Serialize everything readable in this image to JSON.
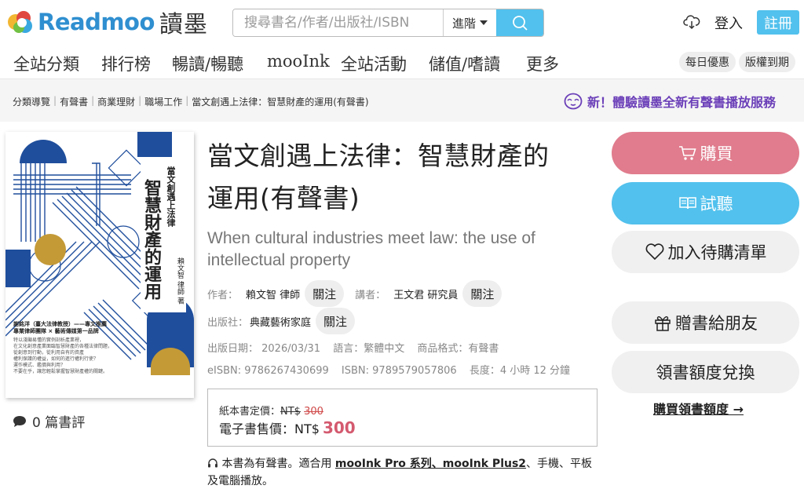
{
  "header": {
    "logo_text": "Readmoo",
    "logo_cn": "讀墨",
    "search_placeholder": "搜尋書名/作者/出版社/ISBN",
    "advanced_label": "進階",
    "login_label": "登入",
    "register_label": "註冊"
  },
  "nav": {
    "items": [
      "全站分類",
      "排行榜",
      "暢讀/暢聽",
      "mooInk",
      "全站活動",
      "儲值/嗜讀",
      "更多"
    ],
    "pills": [
      "每日優惠",
      "版權到期"
    ]
  },
  "breadcrumb": {
    "items": [
      "分類導覽",
      "有聲書",
      "商業理財",
      "職場工作",
      "當文創遇上法律：智慧財產的運用(有聲書)"
    ],
    "promo": "新！體驗讀墨全新有聲書播放服務"
  },
  "book": {
    "title_line1": "當文創遇上法律：智慧財產的",
    "title_line2": "運用(有聲書)",
    "subtitle": "When cultural industries meet law: the use of intellectual property",
    "author_label": "作者：",
    "author": "賴文智 律師",
    "narrator_label": "講者：",
    "narrator": "王文君 研究員",
    "publisher_label": "出版社：",
    "publisher": "典藏藝術家庭",
    "follow_label": "關注",
    "pub_date": "出版日期： 2026/03/31",
    "language": "語言：繁體中文",
    "format": "商品格式：有聲書",
    "eisbn": "eISBN: 9786267430699",
    "isbn": "ISBN: 9789579057806",
    "length": "長度：4 小時 12 分鐘",
    "paper_price_label": "紙本書定價：",
    "paper_price_currency": "NT$",
    "paper_price_value": "300",
    "ebook_price_label": "電子書售價：NT$",
    "ebook_price_value": "300",
    "notice_prefix": "本書為有聲書。適合用",
    "notice_link": "mooInk Pro 系列、mooInk Plus2",
    "notice_suffix": "、手機、平板及電腦播放。",
    "reviews": "0 篇書評"
  },
  "cover": {
    "title_main": "智慧財產的運用",
    "title_top": "當文創遇上法律",
    "author": "賴文智",
    "author_suffix": "律師",
    "author_tail": "著",
    "blurb_head": "謝銘洋（臺大法律教授）——專文推薦",
    "blurb_sub": "專業律師團隊 × 藝術傳媒第一品牌",
    "blurb_body": [
      "特以淺顯易懂的實例剖析產業裡，",
      "在文化創意產業面臨智慧財產的各種法律問題，",
      "從創意到行動，從利用自有的資產",
      "權利保護的權益，如何的進行權利行使？",
      "運作模式、鑑價與利用？",
      "不要在乎，讓您輕鬆掌握智慧財產權的關鍵。"
    ]
  },
  "actions": {
    "buy": "購買",
    "listen": "試聽",
    "wishlist": "加入待購清單",
    "gift": "贈書給朋友",
    "redeem": "領書額度兌換",
    "buy_quota": "購買領書額度 →"
  },
  "colors": {
    "brand_blue": "#52c1ed",
    "buy_pink": "#e07c8d",
    "promo_purple": "#6b3fb8",
    "price_red": "#d45a6f",
    "cover_navy": "#1f4e9c",
    "cover_gold": "#c49a37"
  }
}
